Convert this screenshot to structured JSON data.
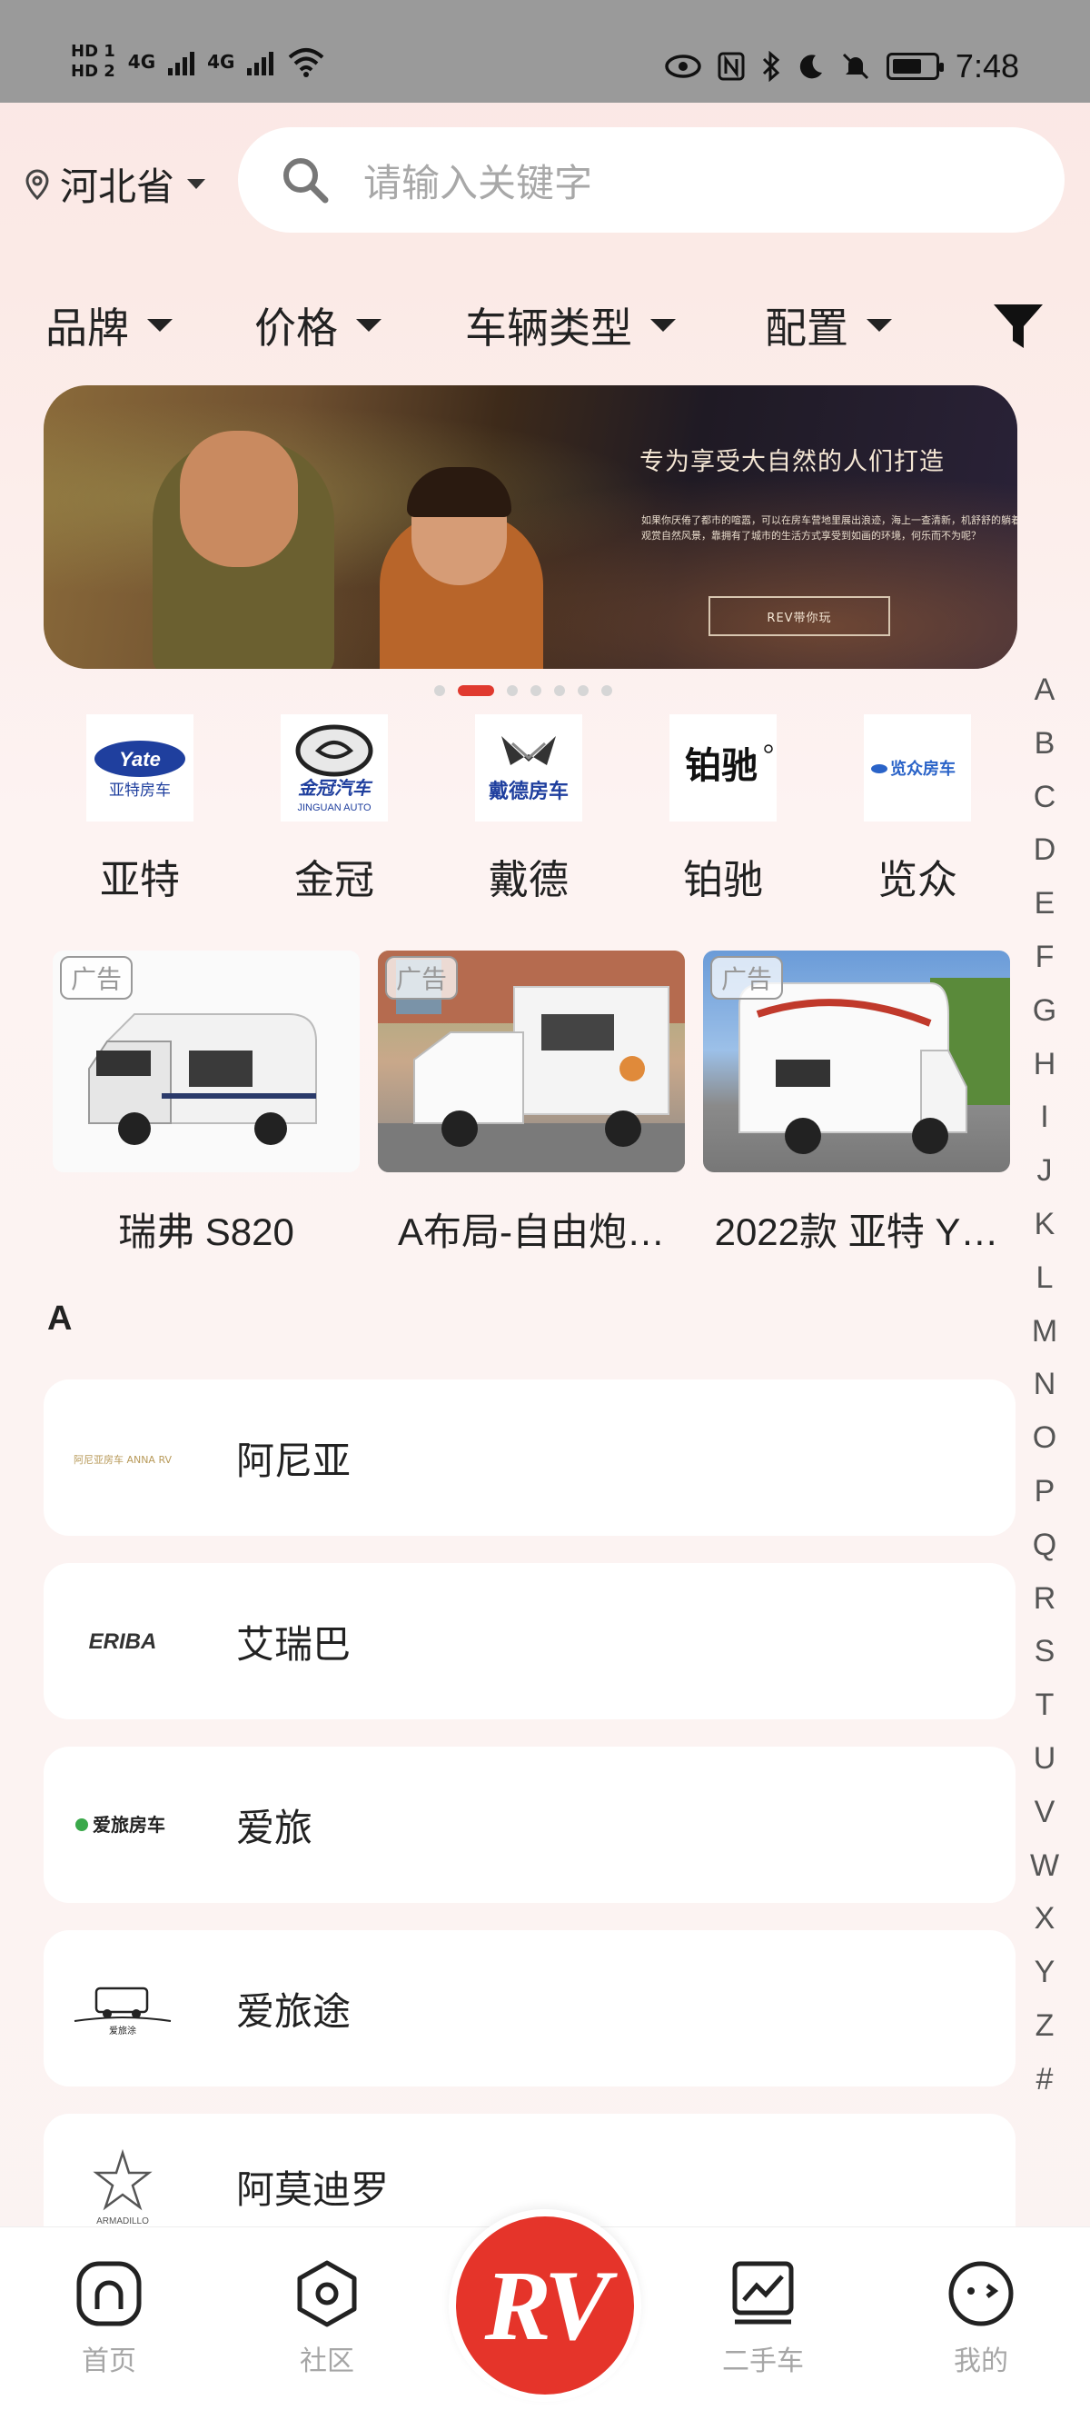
{
  "status_bar": {
    "hd1": "HD 1",
    "hd2": "HD 2",
    "net1": "4G",
    "net2": "4G",
    "time": "7:48"
  },
  "location": {
    "label": "河北省"
  },
  "search": {
    "placeholder": "请输入关键字"
  },
  "filters": [
    {
      "label": "品牌"
    },
    {
      "label": "价格"
    },
    {
      "label": "车辆类型"
    },
    {
      "label": "配置"
    }
  ],
  "banner": {
    "title": "专为享受大自然的人们打造",
    "body": "如果你厌倦了都市的喧嚣，可以在房车营地里展出浪迹，海上一查清新，机舒舒的躺着观赏自然风景，靠拥有了城市的生活方式享受到如画的环境，何乐而不为呢？",
    "button": "REV带你玩",
    "page_count": 7,
    "active_index": 1
  },
  "brands": [
    {
      "name": "亚特",
      "logo_text": "Yate",
      "logo_sub": "亚特房车"
    },
    {
      "name": "金冠",
      "logo_text": "金冠汽车",
      "logo_sub": "JINGUAN AUTO"
    },
    {
      "name": "戴德",
      "logo_text": "戴德房车"
    },
    {
      "name": "铂驰",
      "logo_text": "铂驰"
    },
    {
      "name": "览众",
      "logo_text": "览众房车"
    }
  ],
  "ads": [
    {
      "tag": "广告",
      "title": "瑞弗 S820"
    },
    {
      "tag": "广告",
      "title": "A布局-自由炮…"
    },
    {
      "tag": "广告",
      "title": "2022款 亚特 Y…"
    }
  ],
  "section_letter": "A",
  "list_items": [
    {
      "label": "阿尼亚",
      "logo_text": "阿尼亚房车 ANNA RV"
    },
    {
      "label": "艾瑞巴",
      "logo_text": "ERIBA"
    },
    {
      "label": "爱旅",
      "logo_text": "爱旅房车"
    },
    {
      "label": "爱旅途",
      "logo_text": "爱旅涂"
    },
    {
      "label": "阿莫迪罗",
      "logo_text": "ARMADILLO"
    }
  ],
  "alphabet": [
    "A",
    "B",
    "C",
    "D",
    "E",
    "F",
    "G",
    "H",
    "I",
    "J",
    "K",
    "L",
    "M",
    "N",
    "O",
    "P",
    "Q",
    "R",
    "S",
    "T",
    "U",
    "V",
    "W",
    "X",
    "Y",
    "Z",
    "#"
  ],
  "bottom_nav": {
    "home": "首页",
    "community": "社区",
    "center_logo": "RV",
    "used_car": "二手车",
    "mine": "我的"
  },
  "colors": {
    "accent": "#e5342a",
    "nav_inactive": "#a6a6a6",
    "background": "#fbeeee"
  },
  "icons": {
    "location": "location-pin-icon",
    "search": "search-icon",
    "filter": "funnel-icon"
  }
}
